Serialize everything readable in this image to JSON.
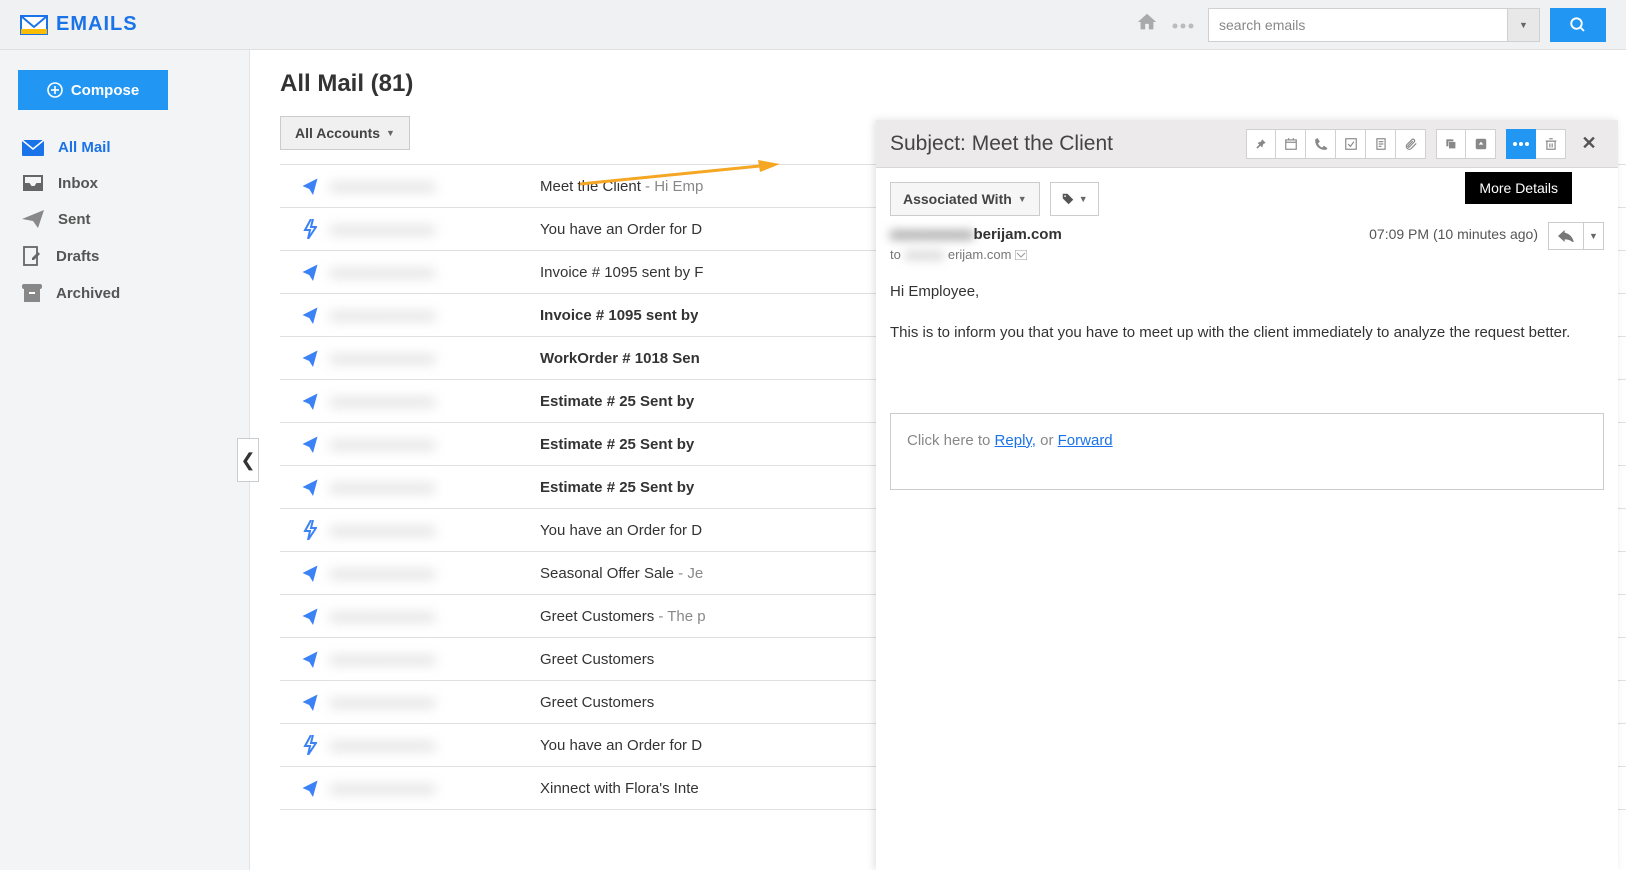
{
  "header": {
    "logo_text": "EMAILS",
    "search_placeholder": "search emails"
  },
  "sidebar": {
    "compose_label": "Compose",
    "items": [
      {
        "label": "All Mail"
      },
      {
        "label": "Inbox"
      },
      {
        "label": "Sent"
      },
      {
        "label": "Drafts"
      },
      {
        "label": "Archived"
      }
    ]
  },
  "main": {
    "title": "All Mail (81)",
    "accounts_label": "All Accounts",
    "emails": [
      {
        "icon": "send",
        "sender": "xxxxxxxxxxxxxxx",
        "subject": "Meet the Client",
        "preview": " - Hi Emp",
        "bold": false
      },
      {
        "icon": "bolt",
        "sender": "xxxxxxxxxxxxxxx",
        "subject": "You have an Order for D",
        "preview": "",
        "bold": false
      },
      {
        "icon": "send",
        "sender": "xxxxxxxxxxxxxxx",
        "subject": "Invoice # 1095 sent by F",
        "preview": "",
        "bold": false
      },
      {
        "icon": "send",
        "sender": "xxxxxxxxxxxxxxx",
        "subject": "Invoice # 1095 sent by",
        "preview": "",
        "bold": true
      },
      {
        "icon": "send",
        "sender": "xxxxxxxxxxxxxxx",
        "subject": "WorkOrder # 1018 Sen",
        "preview": "",
        "bold": true
      },
      {
        "icon": "send",
        "sender": "xxxxxxxxxxxxxxx",
        "subject": "Estimate # 25 Sent by",
        "preview": "",
        "bold": true
      },
      {
        "icon": "send",
        "sender": "xxxxxxxxxxxxxxx",
        "subject": "Estimate # 25 Sent by",
        "preview": "",
        "bold": true
      },
      {
        "icon": "send",
        "sender": "xxxxxxxxxxxxxxx",
        "subject": "Estimate # 25 Sent by",
        "preview": "",
        "bold": true
      },
      {
        "icon": "bolt",
        "sender": "xxxxxxxxxxxxxxx",
        "subject": "You have an Order for D",
        "preview": "",
        "bold": false
      },
      {
        "icon": "send",
        "sender": "xxxxxxxxxxxxxxx",
        "subject": "Seasonal Offer Sale",
        "preview": " - Je",
        "bold": false
      },
      {
        "icon": "send",
        "sender": "xxxxxxxxxxxxxxx",
        "subject": "Greet Customers",
        "preview": " - The p",
        "bold": false
      },
      {
        "icon": "send",
        "sender": "xxxxxxxxxxxxxxx",
        "subject": "Greet Customers",
        "preview": "",
        "bold": false
      },
      {
        "icon": "send",
        "sender": "xxxxxxxxxxxxxxx",
        "subject": "Greet Customers",
        "preview": "",
        "bold": false
      },
      {
        "icon": "bolt",
        "sender": "xxxxxxxxxxxxxxx",
        "subject": "You have an Order for D",
        "preview": "",
        "bold": false
      },
      {
        "icon": "send",
        "sender": "xxxxxxxxxxxxxxx",
        "subject": "Xinnect with Flora's Inte",
        "preview": "",
        "bold": false
      }
    ]
  },
  "pane": {
    "subject_prefix": "Subject: ",
    "subject": "Meet the Client",
    "tooltip": "More Details",
    "associated_label": "Associated With",
    "from_domain": "berijam.com",
    "to_prefix": "to ",
    "to_domain": "erijam.com",
    "timestamp": "07:09 PM (10 minutes ago)",
    "body_greeting": "Hi Employee,",
    "body_text": "This is to inform you that you have to meet up with the client immediately to analyze the request better.",
    "reply_prompt": "Click here to ",
    "reply_link": "Reply,",
    "or_text": " or ",
    "forward_link": "Forward"
  }
}
